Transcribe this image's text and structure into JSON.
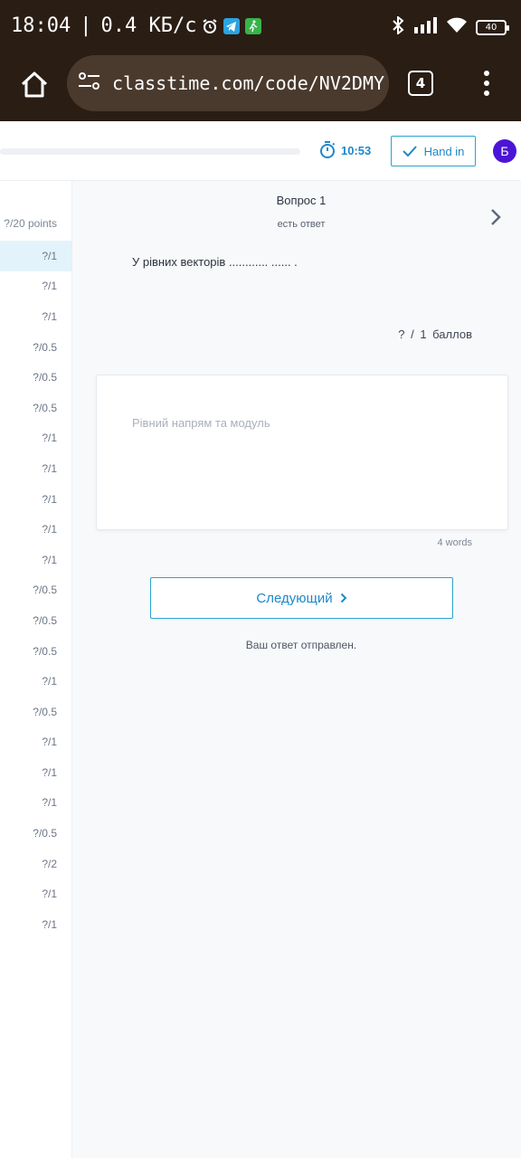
{
  "status_bar": {
    "time": "18:04",
    "separator": "|",
    "network_speed": "0.4 КБ/с",
    "battery": "40",
    "icons": [
      "alarm-icon",
      "telegram-icon",
      "walking-app-icon",
      "bluetooth-icon",
      "signal-icon",
      "wifi-icon",
      "battery-icon"
    ]
  },
  "browser": {
    "url": "classtime.com/code/NV2DMY",
    "tabs_count": "4"
  },
  "header": {
    "timer": "10:53",
    "hand_in_label": "Hand in",
    "avatar_letter": "Б"
  },
  "sidebar": {
    "points_label": "?/20 points",
    "items": [
      {
        "label": "?/1"
      },
      {
        "label": "?/1"
      },
      {
        "label": "?/1"
      },
      {
        "label": "?/0.5"
      },
      {
        "label": "?/0.5"
      },
      {
        "label": "?/0.5"
      },
      {
        "label": "?/1"
      },
      {
        "label": "?/1"
      },
      {
        "label": "?/1"
      },
      {
        "label": "?/1"
      },
      {
        "label": "?/1"
      },
      {
        "label": "?/0.5"
      },
      {
        "label": "?/0.5"
      },
      {
        "label": "?/0.5"
      },
      {
        "label": "?/1"
      },
      {
        "label": "?/0.5"
      },
      {
        "label": "?/1"
      },
      {
        "label": "?/1"
      },
      {
        "label": "?/1"
      },
      {
        "label": "?/0.5"
      },
      {
        "label": "?/2"
      },
      {
        "label": "?/1"
      },
      {
        "label": "?/1"
      }
    ]
  },
  "question": {
    "title": "Вопрос 1",
    "status": "есть ответ",
    "text": "У рівних векторів ............ ...... .",
    "score": "? / 1 баллов",
    "answer": "Рівний напрям та модуль",
    "word_count": "4 words",
    "next_label": "Следующий",
    "sent_message": "Ваш ответ отправлен."
  },
  "colors": {
    "accent": "#1e88c8",
    "avatar": "#4b14d6",
    "system_bar": "#2a1d14"
  }
}
